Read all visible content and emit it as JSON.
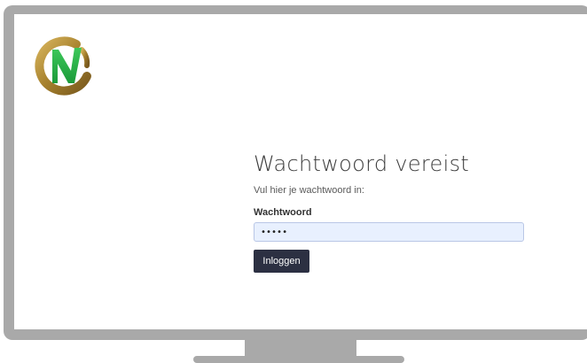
{
  "login": {
    "title": "Wachtwoord vereist",
    "instruction": "Vul hier je wachtwoord in:",
    "password_label": "Wachtwoord",
    "password_value": "•••••",
    "submit_label": "Inloggen"
  },
  "logo": {
    "icon": "nv-logo-icon",
    "colors": {
      "ring": "#b8913a",
      "letter": "#27b34a"
    }
  },
  "colors": {
    "button_bg": "#2c3042",
    "input_bg": "#e8f0fe",
    "monitor_frame": "#a9a9a9"
  }
}
